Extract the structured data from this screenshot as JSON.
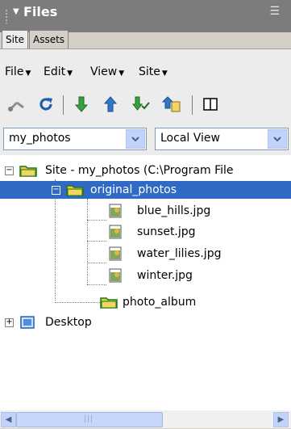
{
  "panel": {
    "title": "Files",
    "tabs": [
      "Site",
      "Assets"
    ]
  },
  "menus": [
    {
      "label": "File"
    },
    {
      "label": "Edit"
    },
    {
      "label": "View"
    },
    {
      "label": "Site"
    }
  ],
  "toolbar": {
    "buttons": [
      "connect-icon",
      "refresh-icon",
      "get-icon",
      "put-icon",
      "check-out-icon",
      "check-in-icon",
      "expand-icon"
    ]
  },
  "site_select": {
    "value": "my_photos"
  },
  "view_select": {
    "value": "Local View"
  },
  "tree": {
    "root_label": "Site - my_photos (C:\\Program File",
    "folder_original": "original_photos",
    "files": [
      "blue_hills.jpg",
      "sunset.jpg",
      "water_lilies.jpg",
      "winter.jpg"
    ],
    "folder_album": "photo_album",
    "desktop": "Desktop"
  },
  "colors": {
    "selection": "#316ac5",
    "title_bg": "#7c7c7c",
    "folder": "#f4d35e"
  }
}
